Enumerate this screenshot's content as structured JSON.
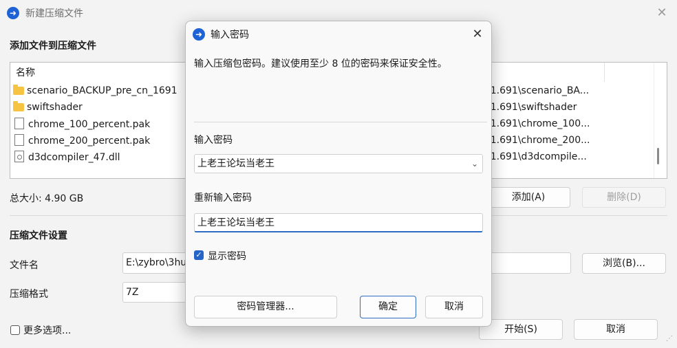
{
  "window": {
    "title": "新建压缩文件",
    "add_files_heading": "添加文件到压缩文件",
    "list": {
      "header_name": "名称",
      "items": [
        {
          "icon": "folder-icon",
          "name": "scenario_BACKUP_pre_cn_1691",
          "path": "r1.691\\scenario_BA..."
        },
        {
          "icon": "folder-icon",
          "name": "swiftshader",
          "path": "r1.691\\swiftshader"
        },
        {
          "icon": "file-icon",
          "name": "chrome_100_percent.pak",
          "path": "r1.691\\chrome_100..."
        },
        {
          "icon": "file-icon",
          "name": "chrome_200_percent.pak",
          "path": "r1.691\\chrome_200..."
        },
        {
          "icon": "dll-icon",
          "name": "d3dcompiler_47.dll",
          "path": "r1.691\\d3dcompile..."
        }
      ]
    },
    "total_size": "总大小: 4.90 GB",
    "add_button": "添加(A)",
    "delete_button": "删除(D)",
    "settings_heading": "压缩文件设置",
    "filename_label": "文件名",
    "filename_value": "E:\\zybro\\3hu",
    "browse_button": "浏览(B)...",
    "format_label": "压缩格式",
    "format_value": "7Z",
    "more_options": "更多选项...",
    "start_button": "开始(S)",
    "cancel_button": "取消"
  },
  "dialog": {
    "title": "输入密码",
    "description": "输入压缩包密码。建议使用至少 8 位的密码来保证安全性。",
    "password_label": "输入密码",
    "password_value": "上老王论坛当老王",
    "reenter_label": "重新输入密码",
    "reenter_value": "上老王论坛当老王",
    "show_password_label": "显示密码",
    "show_password_checked": true,
    "manager_button": "密码管理器...",
    "ok_button": "确定",
    "cancel_button": "取消"
  }
}
